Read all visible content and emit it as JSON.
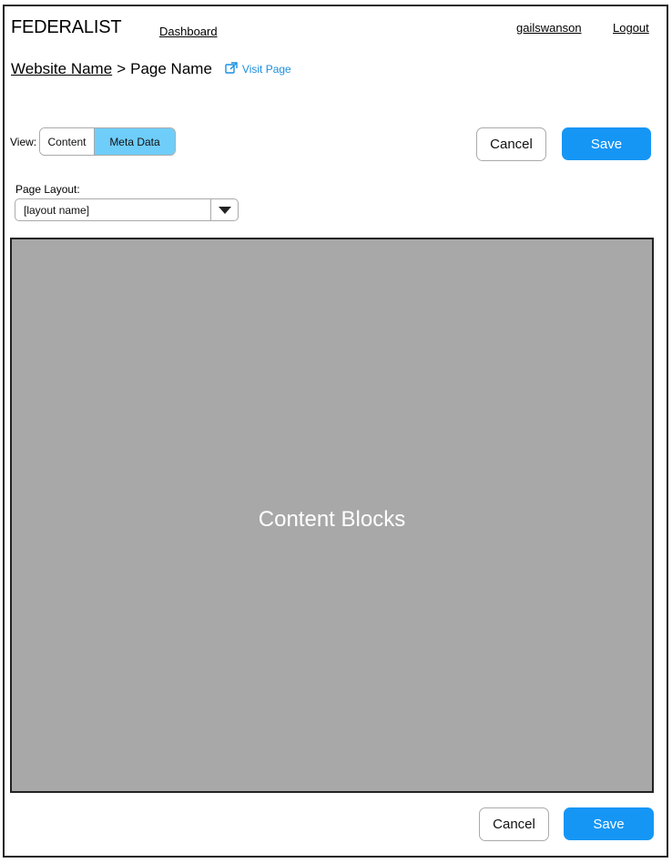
{
  "header": {
    "brand": "FEDERALIST",
    "dashboard_link": "Dashboard",
    "username": "gailswanson",
    "logout_link": "Logout"
  },
  "breadcrumb": {
    "site": "Website Name",
    "separator": ">",
    "page": "Page Name",
    "visit_label": "Visit Page",
    "visit_icon": "external-link-icon"
  },
  "view": {
    "label": "View:",
    "options": [
      "Content",
      "Meta Data"
    ],
    "selected": "Meta Data"
  },
  "actions": {
    "cancel_label": "Cancel",
    "save_label": "Save"
  },
  "layout": {
    "label": "Page Layout:",
    "selected": "[layout name]",
    "caret_icon": "caret-down-icon"
  },
  "content": {
    "placeholder": "Content Blocks"
  },
  "colors": {
    "accent": "#1596f5",
    "toggle_active": "#6fcdfa",
    "link": "#1a8fe0",
    "content_bg": "#a8a8a8"
  }
}
